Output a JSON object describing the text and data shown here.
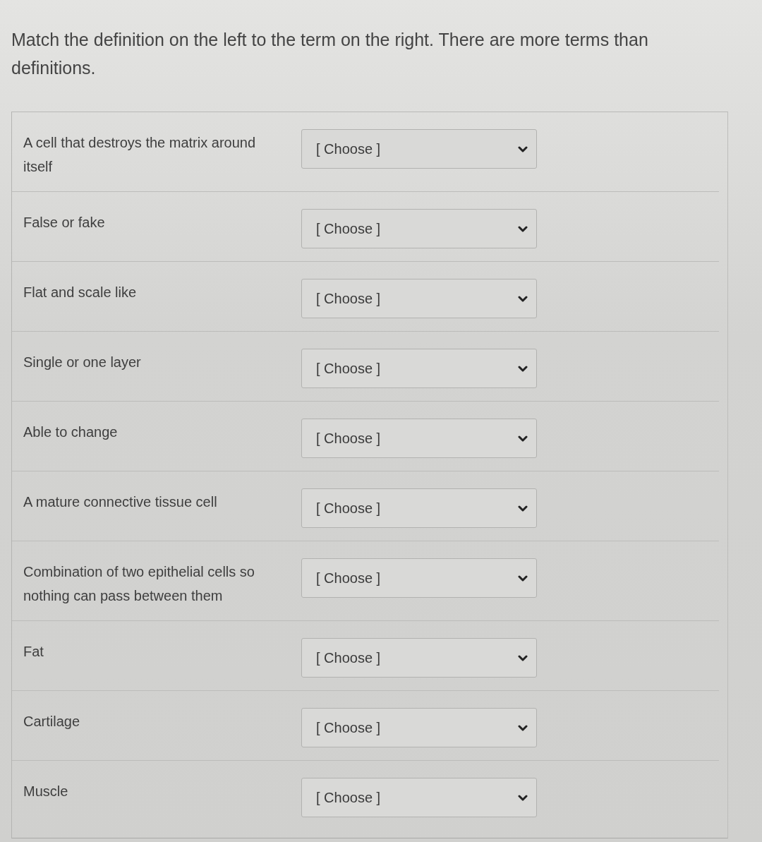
{
  "prompt": "Match the definition on the left to the term on the right. There are more terms than definitions.",
  "pairs": [
    {
      "definition": "A cell that destroys the matrix around itself",
      "answer": {
        "value": "[ Choose ]"
      }
    },
    {
      "definition": "False or fake",
      "answer": {
        "value": "[ Choose ]"
      }
    },
    {
      "definition": "Flat and scale like",
      "answer": {
        "value": "[ Choose ]"
      }
    },
    {
      "definition": "Single or one layer",
      "answer": {
        "value": "[ Choose ]"
      }
    },
    {
      "definition": "Able to change",
      "answer": {
        "value": "[ Choose ]"
      }
    },
    {
      "definition": "A mature connective tissue cell",
      "answer": {
        "value": "[ Choose ]"
      }
    },
    {
      "definition": "Combination of two epithelial cells so nothing can pass between them",
      "answer": {
        "value": "[ Choose ]"
      }
    },
    {
      "definition": "Fat",
      "answer": {
        "value": "[ Choose ]"
      }
    },
    {
      "definition": "Cartilage",
      "answer": {
        "value": "[ Choose ]"
      }
    },
    {
      "definition": "Muscle",
      "answer": {
        "value": "[ Choose ]"
      }
    }
  ]
}
